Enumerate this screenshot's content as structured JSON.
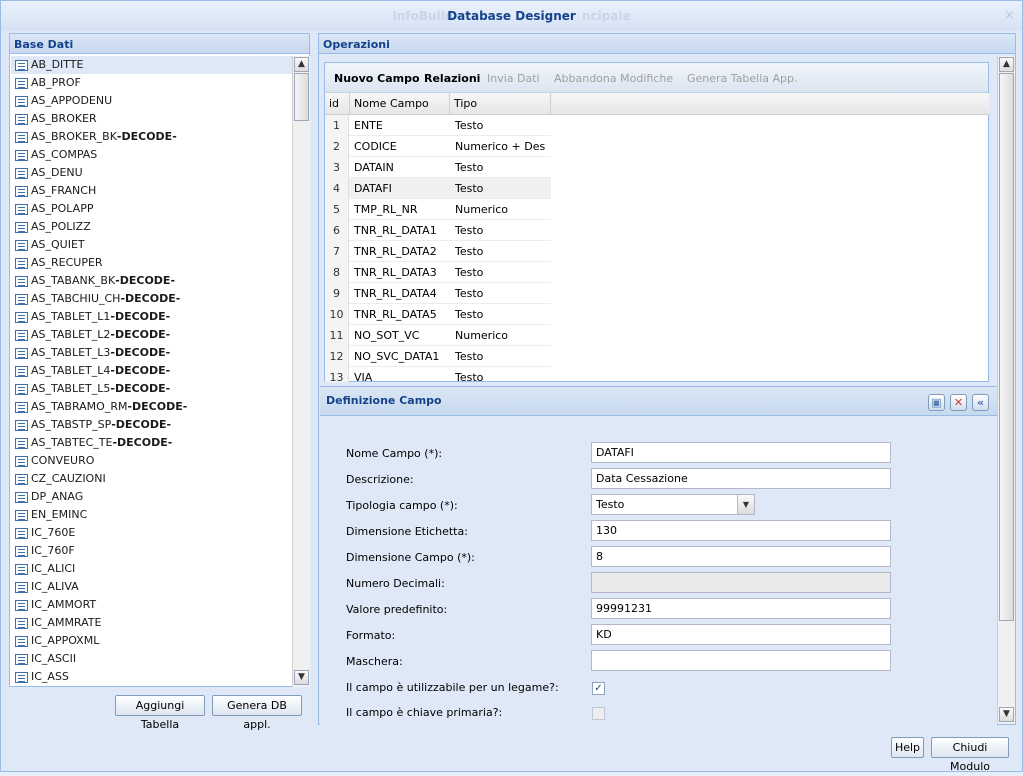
{
  "window": {
    "title": "Database Designer",
    "title_ghost_left": "InfoBuild",
    "title_ghost_right": "ncipale"
  },
  "left_panel": {
    "title": "Base Dati",
    "tables": [
      {
        "name": "AB_DITTE",
        "suffix": ""
      },
      {
        "name": "AB_PROF",
        "suffix": ""
      },
      {
        "name": "AS_APPODENU",
        "suffix": ""
      },
      {
        "name": "AS_BROKER",
        "suffix": ""
      },
      {
        "name": "AS_BROKER_BK",
        "suffix": "-DECODE-"
      },
      {
        "name": "AS_COMPAS",
        "suffix": ""
      },
      {
        "name": "AS_DENU",
        "suffix": ""
      },
      {
        "name": "AS_FRANCH",
        "suffix": ""
      },
      {
        "name": "AS_POLAPP",
        "suffix": ""
      },
      {
        "name": "AS_POLIZZ",
        "suffix": ""
      },
      {
        "name": "AS_QUIET",
        "suffix": ""
      },
      {
        "name": "AS_RECUPER",
        "suffix": ""
      },
      {
        "name": "AS_TABANK_BK",
        "suffix": "-DECODE-"
      },
      {
        "name": "AS_TABCHIU_CH",
        "suffix": "-DECODE-"
      },
      {
        "name": "AS_TABLET_L1",
        "suffix": "-DECODE-"
      },
      {
        "name": "AS_TABLET_L2",
        "suffix": "-DECODE-"
      },
      {
        "name": "AS_TABLET_L3",
        "suffix": "-DECODE-"
      },
      {
        "name": "AS_TABLET_L4",
        "suffix": "-DECODE-"
      },
      {
        "name": "AS_TABLET_L5",
        "suffix": "-DECODE-"
      },
      {
        "name": "AS_TABRAMO_RM",
        "suffix": "-DECODE-"
      },
      {
        "name": "AS_TABSTP_SP",
        "suffix": "-DECODE-"
      },
      {
        "name": "AS_TABTEC_TE",
        "suffix": "-DECODE-"
      },
      {
        "name": "CONVEURO",
        "suffix": ""
      },
      {
        "name": "CZ_CAUZIONI",
        "suffix": ""
      },
      {
        "name": "DP_ANAG",
        "suffix": ""
      },
      {
        "name": "EN_EMINC",
        "suffix": ""
      },
      {
        "name": "IC_760E",
        "suffix": ""
      },
      {
        "name": "IC_760F",
        "suffix": ""
      },
      {
        "name": "IC_ALICI",
        "suffix": ""
      },
      {
        "name": "IC_ALIVA",
        "suffix": ""
      },
      {
        "name": "IC_AMMORT",
        "suffix": ""
      },
      {
        "name": "IC_AMMRATE",
        "suffix": ""
      },
      {
        "name": "IC_APPOXML",
        "suffix": ""
      },
      {
        "name": "IC_ASCII",
        "suffix": ""
      },
      {
        "name": "IC_ASS",
        "suffix": ""
      }
    ],
    "add_table_label": "Aggiungi Tabella",
    "generate_db_label": "Genera DB appl."
  },
  "operations": {
    "title": "Operazioni",
    "toolbar": {
      "new_field": "Nuovo Campo",
      "relations": "Relazioni",
      "send_data": "Invia Dati",
      "abandon": "Abbandona Modifiche",
      "generate_table": "Genera Tabella App."
    },
    "columns": {
      "id": "id",
      "name": "Nome Campo",
      "type": "Tipo"
    },
    "rows": [
      {
        "id": "1",
        "name": "ENTE",
        "type": "Testo"
      },
      {
        "id": "2",
        "name": "CODICE",
        "type": "Numerico + Des"
      },
      {
        "id": "3",
        "name": "DATAIN",
        "type": "Testo"
      },
      {
        "id": "4",
        "name": "DATAFI",
        "type": "Testo"
      },
      {
        "id": "5",
        "name": "TMP_RL_NR",
        "type": "Numerico"
      },
      {
        "id": "6",
        "name": "TNR_RL_DATA1",
        "type": "Testo"
      },
      {
        "id": "7",
        "name": "TNR_RL_DATA2",
        "type": "Testo"
      },
      {
        "id": "8",
        "name": "TNR_RL_DATA3",
        "type": "Testo"
      },
      {
        "id": "9",
        "name": "TNR_RL_DATA4",
        "type": "Testo"
      },
      {
        "id": "10",
        "name": "TNR_RL_DATA5",
        "type": "Testo"
      },
      {
        "id": "11",
        "name": "NO_SOT_VC",
        "type": "Numerico"
      },
      {
        "id": "12",
        "name": "NO_SVC_DATA1",
        "type": "Testo"
      },
      {
        "id": "13",
        "name": "VIA",
        "type": "Testo"
      }
    ]
  },
  "definition": {
    "title": "Definizione Campo",
    "fields": {
      "name_label": "Nome Campo (*):",
      "name_value": "DATAFI",
      "desc_label": "Descrizione:",
      "desc_value": "Data Cessazione",
      "type_label": "Tipologia campo (*):",
      "type_value": "Testo",
      "label_size_label": "Dimensione Etichetta:",
      "label_size_value": "130",
      "field_size_label": "Dimensione Campo (*):",
      "field_size_value": "8",
      "decimals_label": "Numero Decimali:",
      "decimals_value": "",
      "default_label": "Valore predefinito:",
      "default_value": "99991231",
      "format_label": "Formato:",
      "format_value": "KD",
      "mask_label": "Maschera:",
      "mask_value": "",
      "link_label": "Il campo è utilizzabile per un legame?:",
      "pk_label": "Il campo è chiave primaria?:"
    }
  },
  "footer": {
    "help_label": "Help",
    "close_label": "Chiudi Modulo"
  }
}
